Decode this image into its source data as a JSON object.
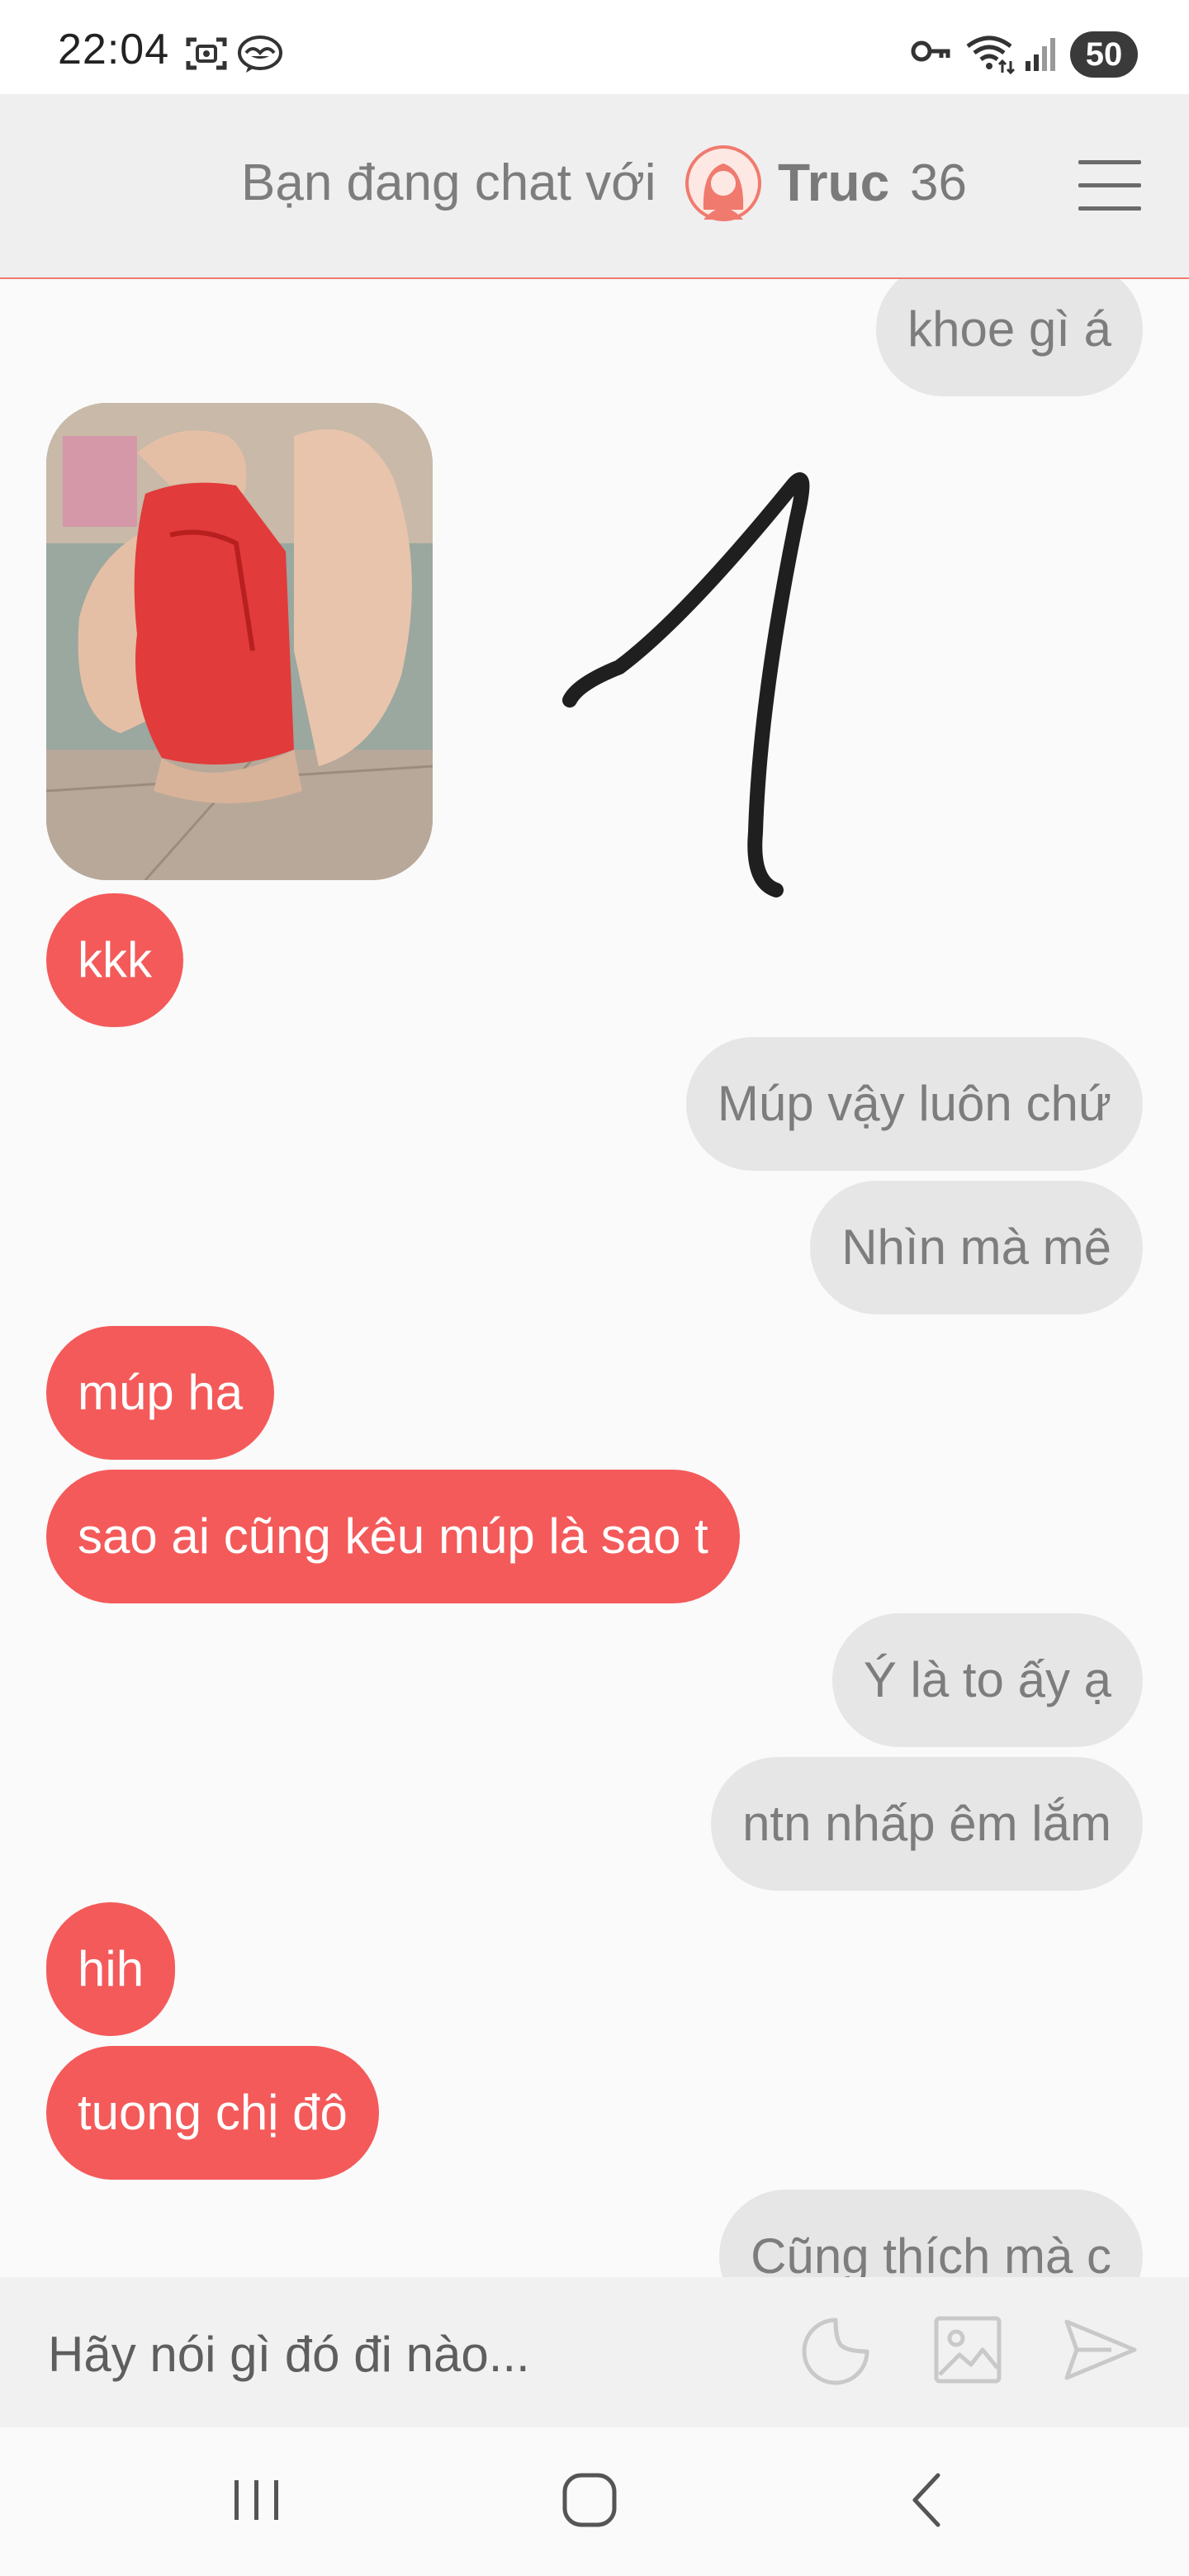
{
  "status_bar": {
    "time": "22:04",
    "icons": [
      "screenshot-icon",
      "messenger-icon",
      "vpn-key-icon",
      "wifi-icon",
      "signal-icon"
    ],
    "battery": "50"
  },
  "header": {
    "prefix": "Bạn đang chat với",
    "name": "Truc",
    "age": "36",
    "menu_icon": "hamburger-menu-icon"
  },
  "messages": [
    {
      "from": "me",
      "text": "khoe gì á"
    },
    {
      "from": "them",
      "type": "image",
      "alt": "photo attachment"
    },
    {
      "from": "them",
      "text": "kkk"
    },
    {
      "from": "me",
      "text": "Múp vậy luôn chứ"
    },
    {
      "from": "me",
      "text": "Nhìn mà mê"
    },
    {
      "from": "them",
      "text": "múp ha"
    },
    {
      "from": "them",
      "text": "sao ai cũng kêu múp là sao t"
    },
    {
      "from": "me",
      "text": "Ý là to ấy ạ"
    },
    {
      "from": "me",
      "text": "ntn nhấp êm lắm"
    },
    {
      "from": "them",
      "text": "hih"
    },
    {
      "from": "them",
      "text": "tuong chị đô"
    },
    {
      "from": "me",
      "text": "Cũng thích mà c"
    }
  ],
  "composer": {
    "placeholder": "Hãy nói gì đó đi nào...",
    "buttons": [
      "sticker-icon",
      "image-icon",
      "send-icon"
    ]
  },
  "nav_bar": {
    "buttons": [
      "recent-apps-icon",
      "home-icon",
      "back-icon"
    ]
  },
  "colors": {
    "incoming_bubble": "#f45a5a",
    "outgoing_bubble": "#e6e6e6",
    "header_bg": "#efefef",
    "accent_line": "#f07a6e"
  }
}
